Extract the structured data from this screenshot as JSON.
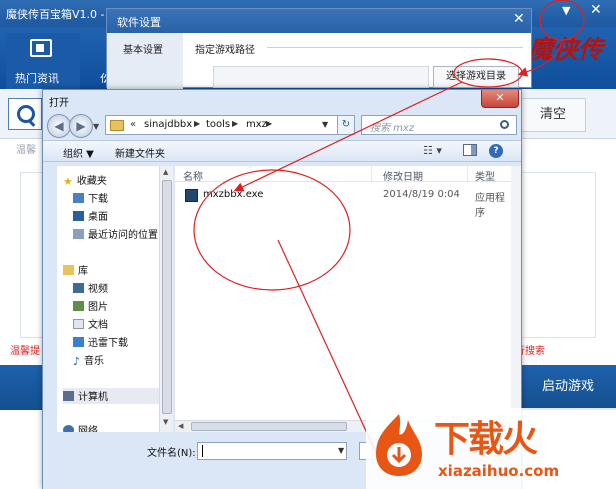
{
  "app": {
    "title": "魔侠传百宝箱V1.0 -",
    "nav_news": "热门资讯",
    "nav_partial": "仫",
    "logo_text": "魔侠传",
    "minimize": "▼",
    "close": "✕",
    "clear_label": "清空",
    "warm_hint": "温馨",
    "warm_red_left": "温馨提",
    "warm_red_right": "行搜索",
    "start_game": "启动游戏"
  },
  "settings": {
    "title": "软件设置",
    "close": "✕",
    "tab_basic": "基本设置",
    "path_label": "指定游戏路径",
    "path_value": "",
    "choose_dir": "选择游戏目录"
  },
  "open_dialog": {
    "title": "打开",
    "close": "✕",
    "back": "◀",
    "forward": "▶",
    "address": {
      "sep0": "«",
      "parts": [
        "sinajdbbx",
        "tools",
        "mxz"
      ],
      "sep": "▶",
      "drop": "▼"
    },
    "refresh": "↻",
    "search_placeholder": "搜索 mxz",
    "organize": "组织 ▼",
    "new_folder": "新建文件夹",
    "view_icon": "☷ ▾",
    "help": "?",
    "nav": {
      "favorites": "收藏夹",
      "downloads": "下载",
      "desktop": "桌面",
      "recent": "最近访问的位置",
      "library": "库",
      "videos": "视频",
      "pictures": "图片",
      "documents": "文档",
      "thunder": "迅雷下载",
      "music": "音乐",
      "computer": "计算机",
      "network": "网络"
    },
    "columns": {
      "name": "名称",
      "date": "修改日期",
      "type": "类型"
    },
    "files": [
      {
        "name": "mxzbbx.exe",
        "date": "2014/8/19 0:04",
        "type": "应用程序"
      }
    ],
    "filename_label": "文件名(N):",
    "filename_value": ""
  },
  "watermark": {
    "text": "下载火",
    "url": "xiazaihuo.com"
  },
  "colors": {
    "accent_blue": "#1f63b0",
    "annotation_red": "#e02020",
    "watermark_orange": "#e85616"
  }
}
